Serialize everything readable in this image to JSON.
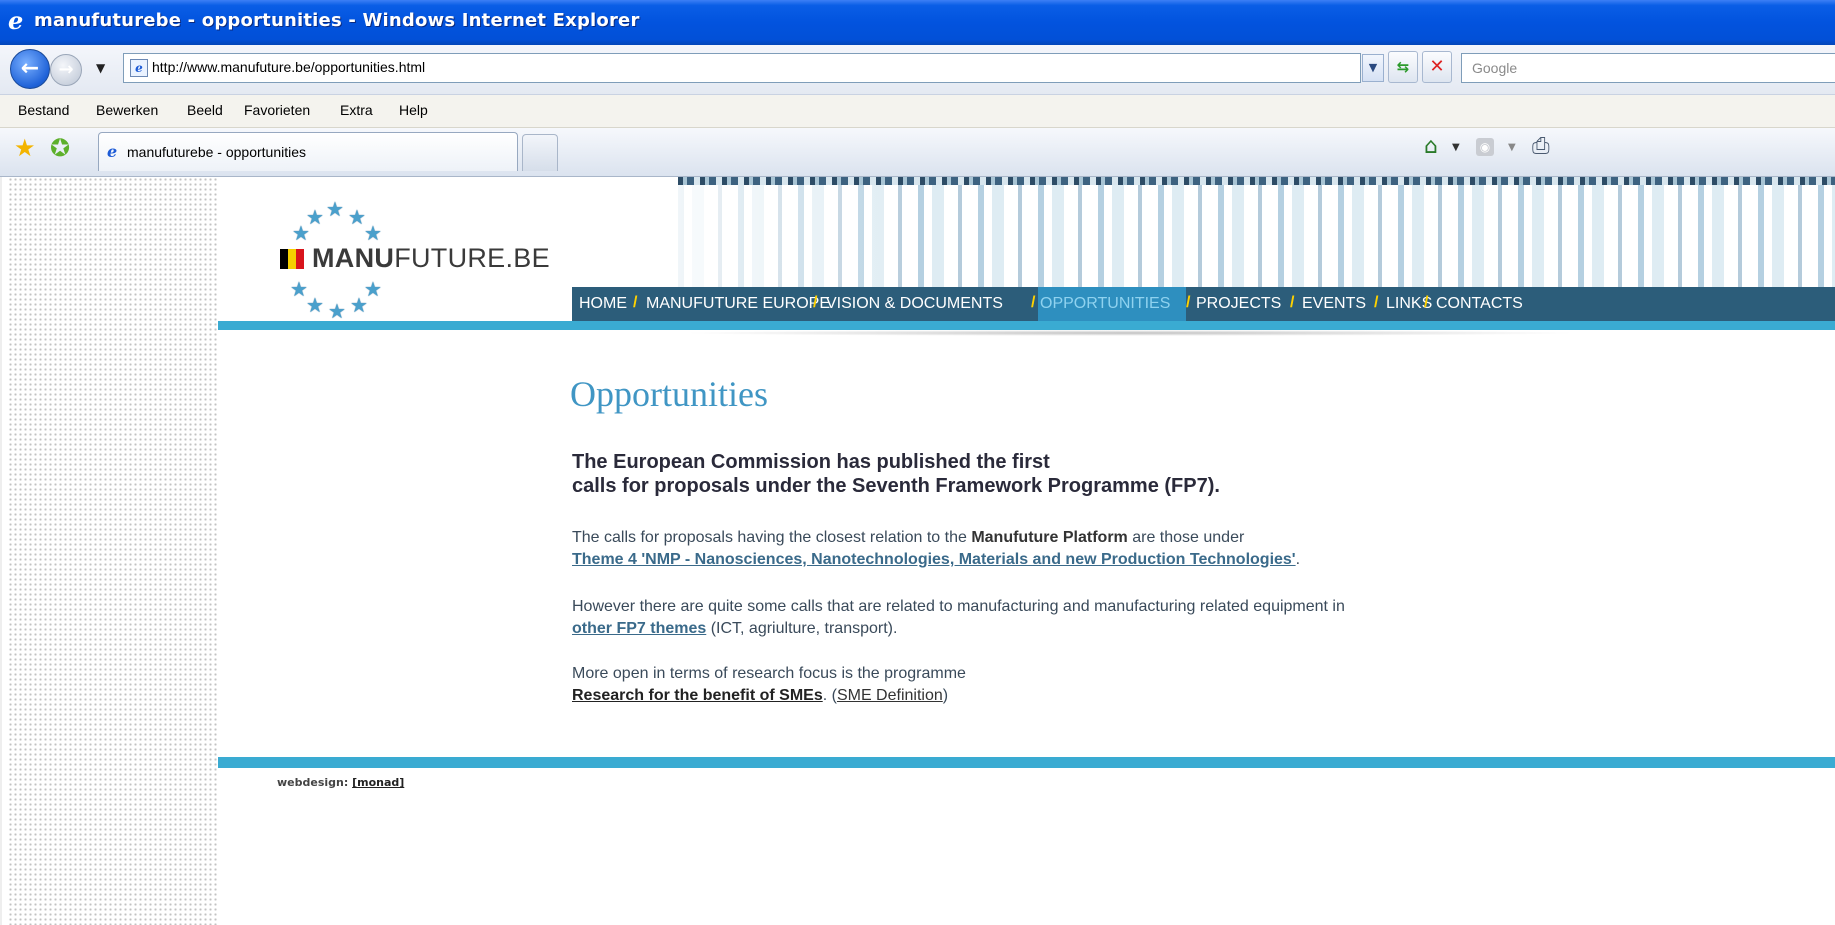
{
  "window": {
    "title": "manufuturebe - opportunities - Windows Internet Explorer"
  },
  "addressbar": {
    "url": "http://www.manufuture.be/opportunities.html",
    "search_placeholder": "Google"
  },
  "menubar": {
    "items": [
      "Bestand",
      "Bewerken",
      "Beeld",
      "Favorieten",
      "Extra",
      "Help"
    ]
  },
  "tabs": [
    {
      "label": "manufuturebe - opportunities",
      "active": true
    }
  ],
  "site": {
    "logo_bold": "MANU",
    "logo_light": "FUTURE.BE",
    "nav": [
      {
        "label": "HOME",
        "active": false
      },
      {
        "label": "MANUFUTURE EUROPE",
        "active": false
      },
      {
        "label": "VISION & DOCUMENTS",
        "active": false
      },
      {
        "label": "OPPORTUNITIES",
        "active": true
      },
      {
        "label": "PROJECTS",
        "active": false
      },
      {
        "label": "EVENTS",
        "active": false
      },
      {
        "label": "LINKS",
        "active": false
      },
      {
        "label": "CONTACTS",
        "active": false
      }
    ],
    "nav_separator": "/"
  },
  "page": {
    "title": "Opportunities",
    "lead_line1": "The European Commission has published the first",
    "lead_line2": "calls for proposals under the Seventh Framework Programme (FP7).",
    "p1_text": "The calls for proposals having the closest relation to the ",
    "p1_bold": "Manufuture Platform",
    "p1_text2": " are those under",
    "p1_link": "Theme 4 'NMP - Nanosciences, Nanotechnologies, Materials and new Production Technologies'",
    "p1_end": ".",
    "p2_text": "However there are quite some calls that are related to manufacturing and manufacturing related equipment in",
    "p2_link": "other FP7 themes",
    "p2_end": " (ICT, agriulture, transport).",
    "p3_text": "More open in terms of research focus is the programme",
    "p3_link": "Research for the benefit of SMEs",
    "p3_mid": ". (",
    "p3_link2": "SME Definition",
    "p3_end": ")"
  },
  "footer": {
    "label": "webdesign: ",
    "link": "[monad]"
  },
  "colors": {
    "accent": "#3aabd2",
    "nav_bg": "#2c5d7a",
    "nav_active_bg": "#2e8fbf",
    "nav_separator": "#ffd200",
    "title": "#4096c4"
  }
}
